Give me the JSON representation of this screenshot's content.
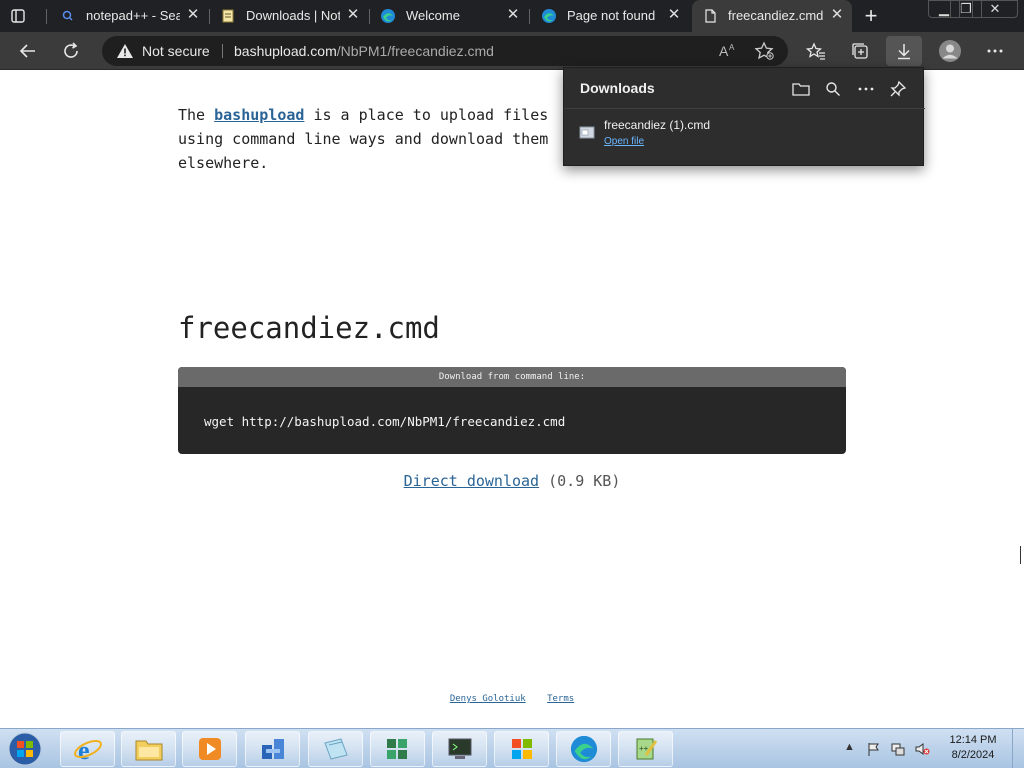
{
  "tabs": [
    {
      "title": "notepad++ - Search",
      "icon": "search-icon"
    },
    {
      "title": "Downloads | Notepad",
      "icon": "notepad-icon"
    },
    {
      "title": "Welcome",
      "icon": "edge-icon"
    },
    {
      "title": "Page not found",
      "icon": "edge-icon"
    },
    {
      "title": "freecandiez.cmd / bashupload",
      "icon": "page-icon",
      "active": true
    }
  ],
  "address": {
    "security_label": "Not secure",
    "url_host": "bashupload.com",
    "url_path": "/NbPM1/freecandiez.cmd"
  },
  "page": {
    "intro_prefix": "The ",
    "intro_link": "bashupload",
    "intro_suffix": " is a place to upload files using command line ways and download them elsewhere.",
    "file_title": "freecandiez.cmd",
    "cmd_header": "Download from command line:",
    "cmd_text": "wget http://bashupload.com/NbPM1/freecandiez.cmd",
    "direct_link": "Direct download",
    "size_text": " (0.9 KB)",
    "footer_author": "Denys Golotiuk",
    "footer_terms": "Terms"
  },
  "downloads_panel": {
    "title": "Downloads",
    "item_name": "freecandiez (1).cmd",
    "item_action": "Open file"
  },
  "clock": {
    "time": "12:14 PM",
    "date": "8/2/2024"
  },
  "colors": {
    "accent": "#2a6496",
    "dark_chrome": "#202124",
    "toolbar": "#3b3b3b",
    "link_blue": "#6bb6ff"
  }
}
